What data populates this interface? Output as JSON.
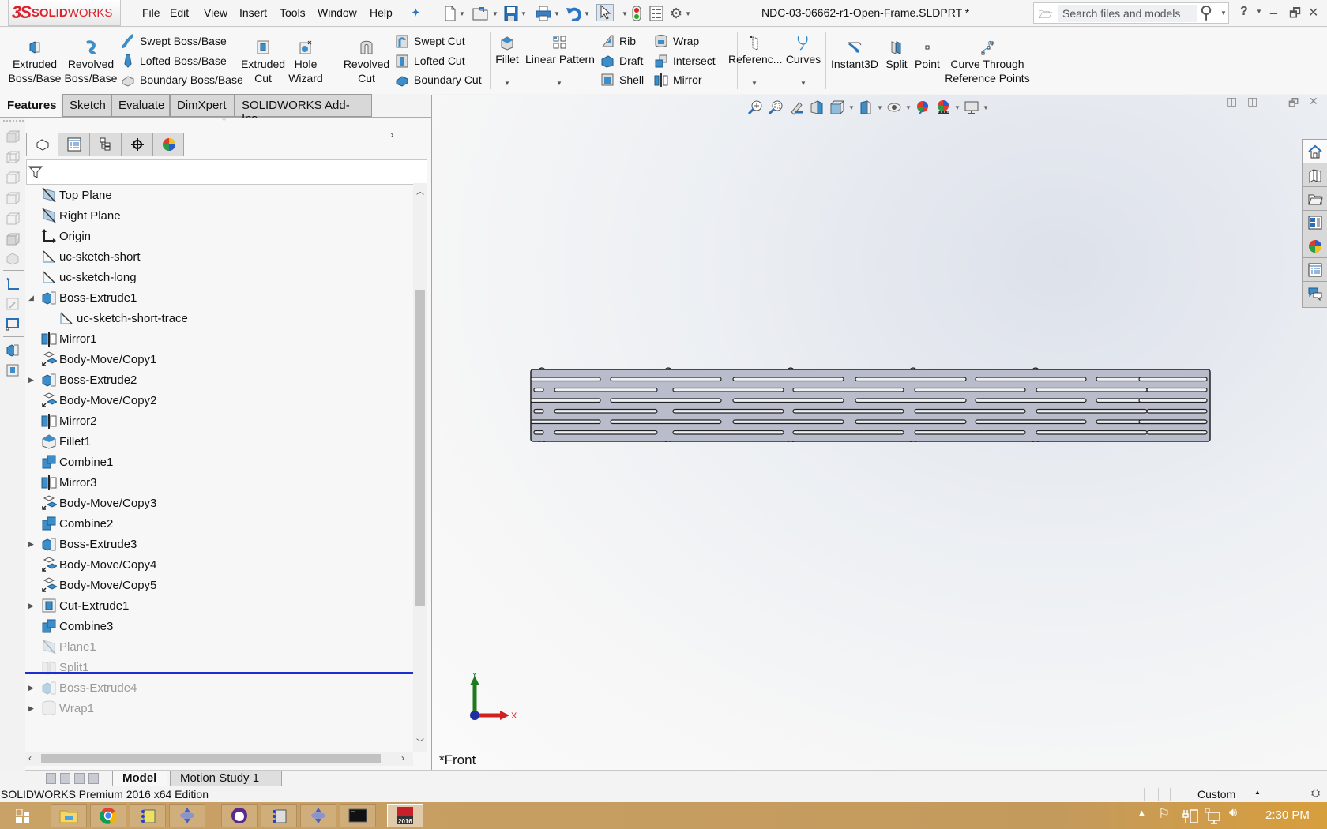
{
  "app": {
    "logo_ds": "3S",
    "logo_brand_bold": "SOLID",
    "logo_brand_light": "WORKS",
    "document_title": "NDC-03-06662-r1-Open-Frame.SLDPRT *"
  },
  "menu": [
    "File",
    "Edit",
    "View",
    "Insert",
    "Tools",
    "Window",
    "Help"
  ],
  "search": {
    "placeholder": "Search files and models"
  },
  "ribbon": {
    "extruded_boss": "Extruded\nBoss/Base",
    "extruded_boss_l1": "Extruded",
    "extruded_boss_l2": "Boss/Base",
    "revolved_boss_l1": "Revolved",
    "revolved_boss_l2": "Boss/Base",
    "swept_boss": "Swept Boss/Base",
    "lofted_boss": "Lofted Boss/Base",
    "boundary_boss": "Boundary Boss/Base",
    "extruded_cut_l1": "Extruded",
    "extruded_cut_l2": "Cut",
    "hole_wizard_l1": "Hole",
    "hole_wizard_l2": "Wizard",
    "revolved_cut_l1": "Revolved",
    "revolved_cut_l2": "Cut",
    "swept_cut": "Swept Cut",
    "lofted_cut": "Lofted Cut",
    "boundary_cut": "Boundary Cut",
    "fillet": "Fillet",
    "linear_pattern": "Linear Pattern",
    "rib": "Rib",
    "draft": "Draft",
    "shell": "Shell",
    "wrap": "Wrap",
    "intersect": "Intersect",
    "mirror": "Mirror",
    "reference": "Referenc...",
    "curves": "Curves",
    "instant3d": "Instant3D",
    "split": "Split",
    "point": "Point",
    "curve_through_l1": "Curve Through",
    "curve_through_l2": "Reference Points"
  },
  "tabs": [
    {
      "label": "Features",
      "active": true
    },
    {
      "label": "Sketch"
    },
    {
      "label": "Evaluate"
    },
    {
      "label": "DimXpert"
    },
    {
      "label": "SOLIDWORKS Add-Ins"
    }
  ],
  "feature_tree": [
    {
      "label": "Top Plane",
      "icon": "plane-icon"
    },
    {
      "label": "Right Plane",
      "icon": "plane-icon"
    },
    {
      "label": "Origin",
      "icon": "origin-icon"
    },
    {
      "label": "uc-sketch-short",
      "icon": "sketch-icon"
    },
    {
      "label": "uc-sketch-long",
      "icon": "sketch-icon"
    },
    {
      "label": "Boss-Extrude1",
      "icon": "extrude-icon",
      "expander": "expanded"
    },
    {
      "label": "uc-sketch-short-trace",
      "icon": "sketch-icon",
      "indent": 1
    },
    {
      "label": "Mirror1",
      "icon": "mirror-icon"
    },
    {
      "label": "Body-Move/Copy1",
      "icon": "move-copy-icon"
    },
    {
      "label": "Boss-Extrude2",
      "icon": "extrude-icon",
      "expander": "collapsed"
    },
    {
      "label": "Body-Move/Copy2",
      "icon": "move-copy-icon"
    },
    {
      "label": "Mirror2",
      "icon": "mirror-icon"
    },
    {
      "label": "Fillet1",
      "icon": "fillet-icon"
    },
    {
      "label": "Combine1",
      "icon": "combine-icon"
    },
    {
      "label": "Mirror3",
      "icon": "mirror-icon"
    },
    {
      "label": "Body-Move/Copy3",
      "icon": "move-copy-icon"
    },
    {
      "label": "Combine2",
      "icon": "combine-icon"
    },
    {
      "label": "Boss-Extrude3",
      "icon": "extrude-icon",
      "expander": "collapsed"
    },
    {
      "label": "Body-Move/Copy4",
      "icon": "move-copy-icon"
    },
    {
      "label": "Body-Move/Copy5",
      "icon": "move-copy-icon"
    },
    {
      "label": "Cut-Extrude1",
      "icon": "cut-extrude-icon",
      "expander": "collapsed"
    },
    {
      "label": "Combine3",
      "icon": "combine-icon"
    },
    {
      "label": "Plane1",
      "icon": "plane-icon",
      "suppressed": true
    },
    {
      "label": "Split1",
      "icon": "split-icon",
      "suppressed": true
    },
    {
      "label": "Boss-Extrude4",
      "icon": "extrude-icon",
      "expander": "collapsed",
      "suppressed": true
    },
    {
      "label": "Wrap1",
      "icon": "wrap-icon",
      "expander": "collapsed",
      "suppressed": true
    }
  ],
  "viewport": {
    "view_name": "*Front",
    "triad": {
      "x": "X",
      "y": "Y"
    }
  },
  "bottom_tabs": [
    {
      "label": "Model",
      "active": true
    },
    {
      "label": "Motion Study 1"
    }
  ],
  "status": {
    "edition": "SOLIDWORKS Premium 2016 x64 Edition",
    "units": "Custom"
  },
  "taskbar": {
    "clock": "2:30 PM",
    "apps": [
      "file-explorer",
      "chrome",
      "network-app",
      "vpn-app",
      "eclipse-app",
      "network-app-2",
      "vpn-app-2",
      "terminal",
      "solidworks-2016"
    ]
  },
  "colors": {
    "brand": "#d9232e",
    "rollback_bar": "#1a2ed1",
    "part_fill": "#b8bccb",
    "triad_x": "#d02020",
    "triad_y": "#1f7a1f",
    "triad_z": "#1f2fa0"
  }
}
